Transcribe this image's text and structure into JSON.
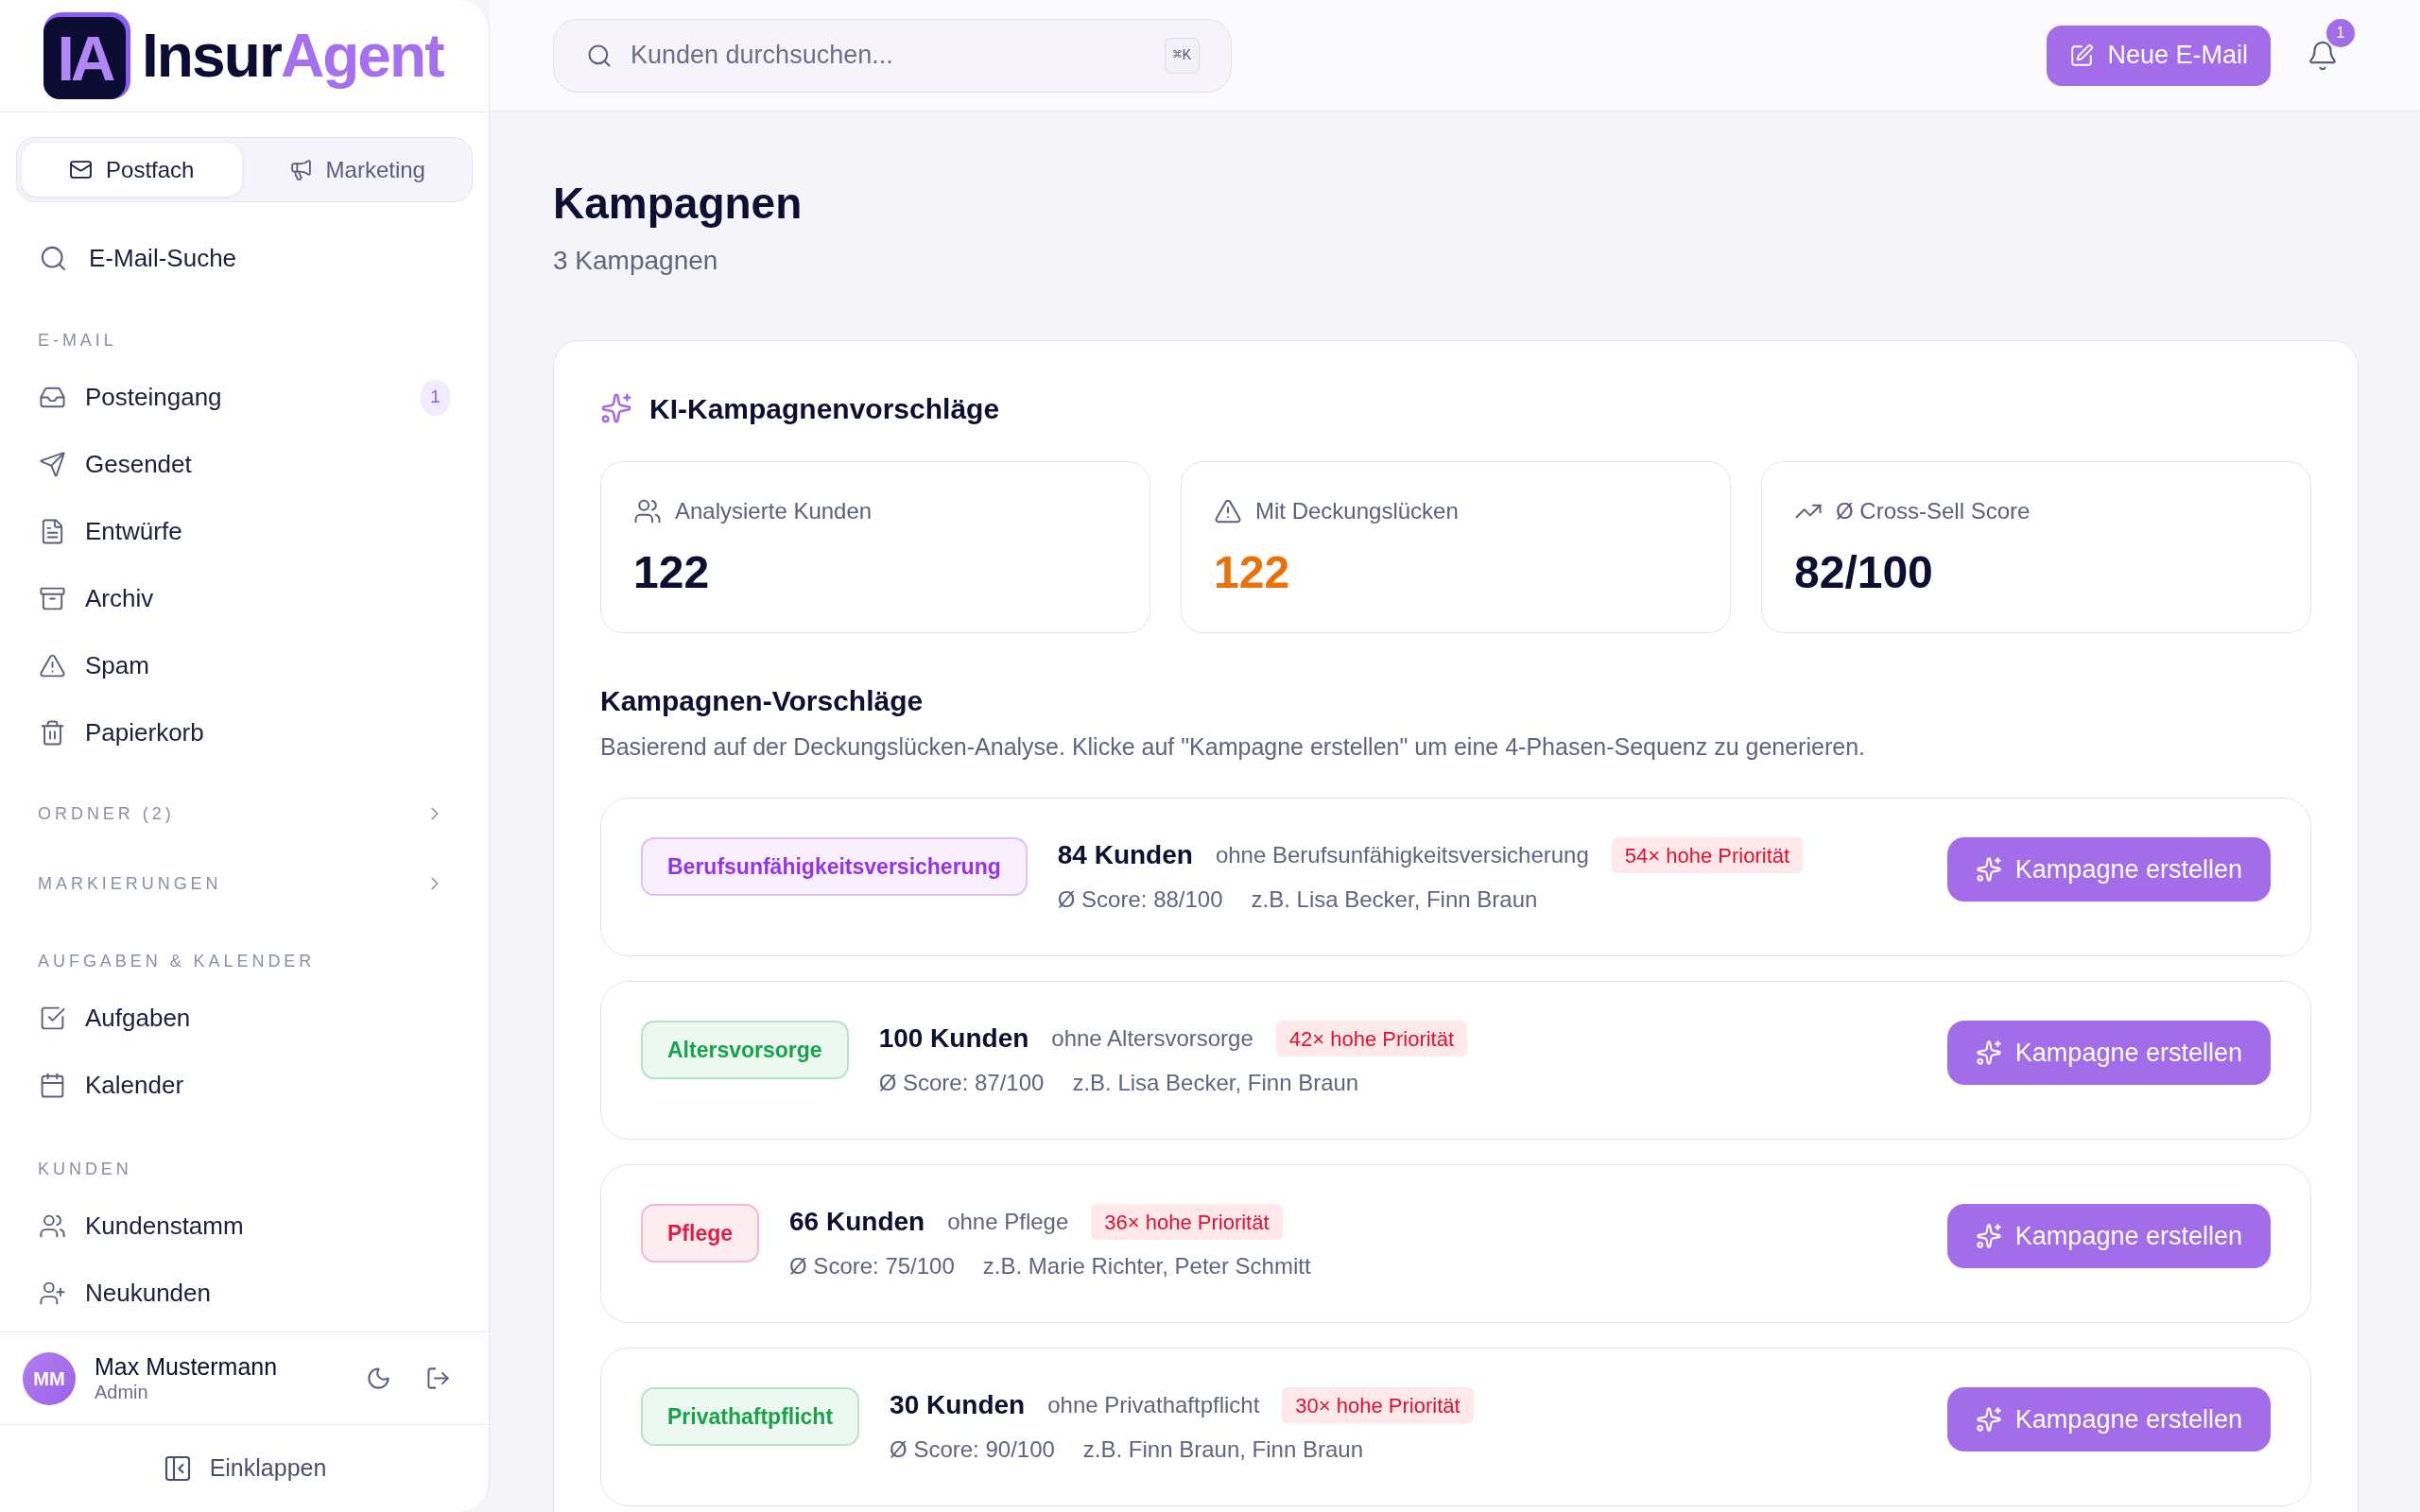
{
  "sidebar": {
    "logo": {
      "mark": "IA",
      "name_start": "Insur",
      "name_end": "Agent"
    },
    "mode_tabs": [
      {
        "label": "Postfach",
        "selected": true
      },
      {
        "label": "Marketing",
        "selected": false
      }
    ],
    "search_link": "E-Mail-Suche",
    "sections": [
      {
        "kind": "group",
        "title": "E-MAIL",
        "items": [
          {
            "label": "Posteingang",
            "badge": "1",
            "selected": false
          },
          {
            "label": "Gesendet",
            "selected": false
          },
          {
            "label": "Entwürfe",
            "selected": false
          },
          {
            "label": "Archiv",
            "selected": false
          },
          {
            "label": "Spam",
            "selected": false
          },
          {
            "label": "Papierkorb",
            "selected": false
          }
        ]
      },
      {
        "kind": "collapsible",
        "title": "ORDNER (2)",
        "expanded": false
      },
      {
        "kind": "collapsible",
        "title": "MARKIERUNGEN",
        "expanded": false
      },
      {
        "kind": "group",
        "title": "AUFGABEN & KALENDER",
        "items": [
          {
            "label": "Aufgaben",
            "selected": false
          },
          {
            "label": "Kalender",
            "selected": false
          }
        ]
      },
      {
        "kind": "group",
        "title": "KUNDEN",
        "items": [
          {
            "label": "Kundenstamm",
            "selected": false
          },
          {
            "label": "Neukunden",
            "selected": false
          }
        ]
      }
    ],
    "user": {
      "initials": "MM",
      "name": "Max Mustermann",
      "role": "Admin"
    },
    "collapse_button": "Einklappen"
  },
  "header": {
    "search": {
      "placeholder": "Kunden durchsuchen...",
      "shortcut": "⌘K"
    },
    "new_email_button": "Neue E-Mail",
    "notifications": {
      "count": "1"
    }
  },
  "page": {
    "title": "Kampagnen",
    "subtitle": "3 Kampagnen"
  },
  "ai_panel": {
    "title": "KI-Kampagnenvorschläge",
    "stats": [
      {
        "label": "Analysierte Kunden",
        "value": "122",
        "color": "#0d1033"
      },
      {
        "label": "Mit Deckungslücken",
        "value": "122",
        "color": "#e8710a"
      },
      {
        "label": "Ø Cross-Sell Score",
        "value": "82/100",
        "color": "#0d1033"
      }
    ],
    "suggestions": {
      "title": "Kampagnen-Vorschläge",
      "description": "Basierend auf der Deckungslücken-Analyse. Klicke auf \"Kampagne erstellen\" um eine 4-Phasen-Sequenz zu generieren.",
      "campaigns": [
        {
          "tag": "Berufsunfähigkeitsversicherung",
          "color": "#9333ea",
          "count": "84 Kunden",
          "gap": "ohne Berufsunfähigkeitsversicherung",
          "priority": "54× hohe Priorität",
          "score": "Ø Score: 88/100",
          "examples": "z.B. Lisa Becker, Finn Braun",
          "button": "Kampagne erstellen"
        },
        {
          "tag": "Altersvorsorge",
          "color": "#16a34a",
          "count": "100 Kunden",
          "gap": "ohne Altersvorsorge",
          "priority": "42× hohe Priorität",
          "score": "Ø Score: 87/100",
          "examples": "z.B. Lisa Becker, Finn Braun",
          "button": "Kampagne erstellen"
        },
        {
          "tag": "Pflege",
          "color": "#e11d48",
          "count": "66 Kunden",
          "gap": "ohne Pflege",
          "priority": "36× hohe Priorität",
          "score": "Ø Score: 75/100",
          "examples": "z.B. Marie Richter, Peter Schmitt",
          "button": "Kampagne erstellen"
        },
        {
          "tag": "Privathaftpflicht",
          "color": "#16a34a",
          "count": "30 Kunden",
          "gap": "ohne Privathaftpflicht",
          "priority": "30× hohe Priorität",
          "score": "Ø Score: 90/100",
          "examples": "z.B. Finn Braun, Finn Braun",
          "button": "Kampagne erstellen"
        }
      ]
    }
  }
}
